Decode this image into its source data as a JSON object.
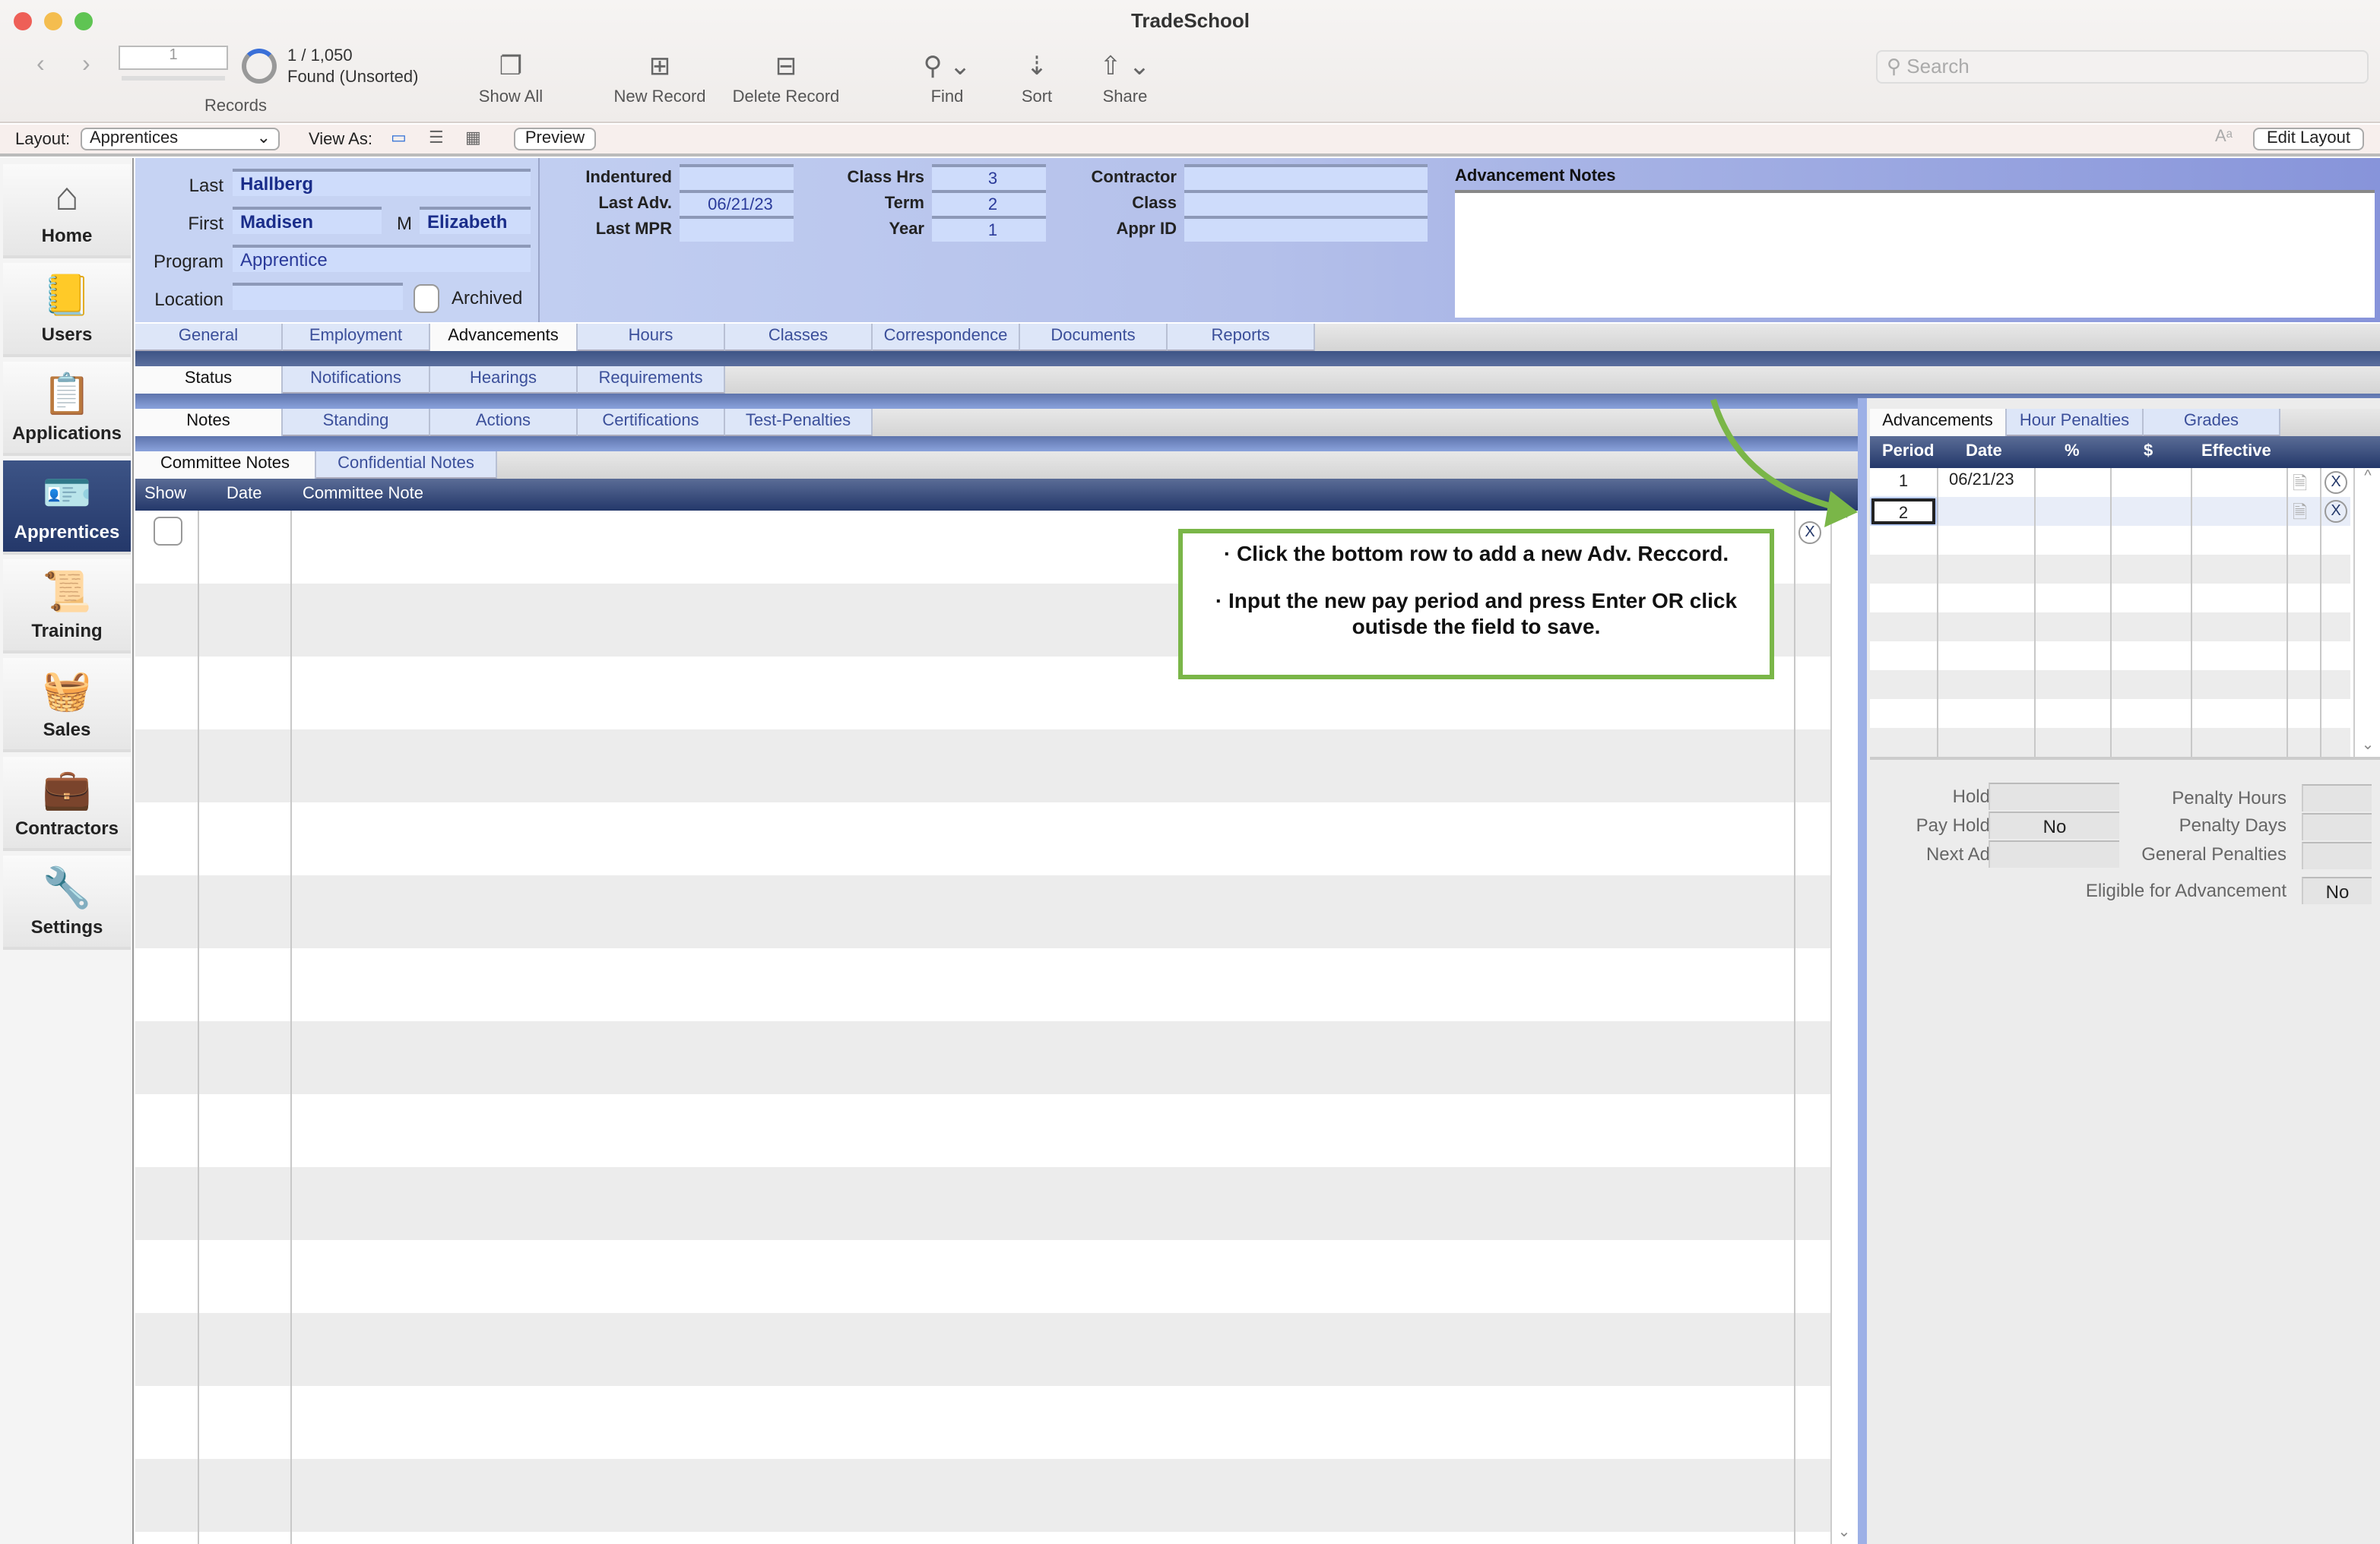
{
  "window": {
    "title": "TradeSchool"
  },
  "toolbar": {
    "record_number": "1",
    "record_count": "1 / 1,050",
    "found_status": "Found (Unsorted)",
    "records_label": "Records",
    "show_all": "Show All",
    "new_record": "New Record",
    "delete_record": "Delete Record",
    "find": "Find",
    "sort": "Sort",
    "share": "Share",
    "search_placeholder": "Search"
  },
  "layoutbar": {
    "layout_label": "Layout:",
    "layout_value": "Apprentices",
    "view_as_label": "View As:",
    "preview": "Preview",
    "edit_layout": "Edit Layout"
  },
  "sidebar": {
    "items": [
      {
        "label": "Home",
        "icon": "house-icon"
      },
      {
        "label": "Users",
        "icon": "address-book-icon"
      },
      {
        "label": "Applications",
        "icon": "clipboard-icon"
      },
      {
        "label": "Apprentices",
        "icon": "id-badge-icon",
        "selected": true
      },
      {
        "label": "Training",
        "icon": "certificate-icon"
      },
      {
        "label": "Sales",
        "icon": "cash-register-icon"
      },
      {
        "label": "Contractors",
        "icon": "briefcase-icon"
      },
      {
        "label": "Settings",
        "icon": "wrench-icon"
      }
    ]
  },
  "record": {
    "last_label": "Last",
    "last": "Hallberg",
    "first_label": "First",
    "first": "Madisen",
    "middle_label": "M",
    "middle": "Elizabeth",
    "program_label": "Program",
    "program": "Apprentice",
    "location_label": "Location",
    "location": "",
    "archived_label": "Archived",
    "indentured_label": "Indentured",
    "indentured": "",
    "last_adv_label": "Last Adv.",
    "last_adv": "06/21/23",
    "last_mpr_label": "Last MPR",
    "last_mpr": "",
    "class_hrs_label": "Class Hrs",
    "class_hrs": "3",
    "term_label": "Term",
    "term": "2",
    "year_label": "Year",
    "year": "1",
    "contractor_label": "Contractor",
    "contractor": "",
    "class_label": "Class",
    "class": "",
    "appr_id_label": "Appr ID",
    "appr_id": "",
    "adv_notes_label": "Advancement Notes",
    "adv_notes": ""
  },
  "tabs": {
    "main": [
      "General",
      "Employment",
      "Advancements",
      "Hours",
      "Classes",
      "Correspondence",
      "Documents",
      "Reports"
    ],
    "sub": [
      "Status",
      "Notifications",
      "Hearings",
      "Requirements"
    ],
    "sub2": [
      "Notes",
      "Standing",
      "Actions",
      "Certifications",
      "Test-Penalties"
    ],
    "notes": [
      "Committee Notes",
      "Confidential Notes"
    ]
  },
  "notes_table": {
    "columns": [
      "Show",
      "Date",
      "Committee Note"
    ]
  },
  "callout": {
    "line1": "· Click the bottom row to add a new Adv. Reccord.",
    "line2": "· Input the new pay period and press Enter OR click outisde the field to save.",
    "color": "#7ab648"
  },
  "right_panel": {
    "tabs": [
      "Advancements",
      "Hour Penalties",
      "Grades"
    ],
    "columns": [
      "Period",
      "Date",
      "%",
      "$",
      "Effective"
    ],
    "rows": [
      {
        "period": "1",
        "date": "06/21/23"
      },
      {
        "period": "2",
        "date": ""
      }
    ],
    "holds_label": "Holds",
    "holds": "",
    "pay_holds_label": "Pay Holds",
    "pay_holds": "No",
    "next_adv_label": "Next Adv",
    "next_adv": "",
    "penalty_hours_label": "Penalty Hours",
    "penalty_hours": "",
    "penalty_days_label": "Penalty Days",
    "penalty_days": "",
    "general_penalties_label": "General Penalties",
    "general_penalties": "",
    "eligible_label": "Eligible for Advancement",
    "eligible": "No"
  }
}
